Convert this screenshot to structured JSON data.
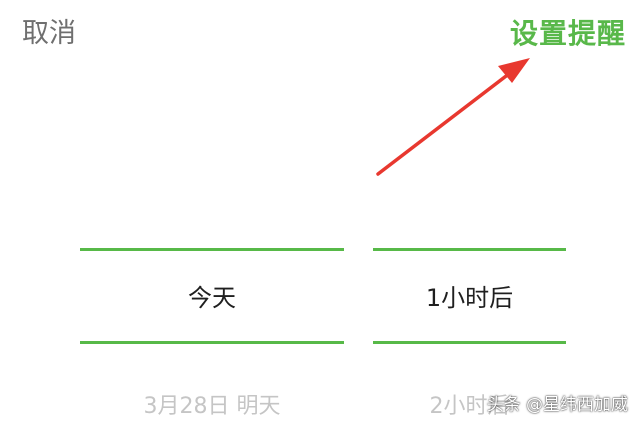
{
  "header": {
    "cancel_label": "取消",
    "confirm_label": "设置提醒"
  },
  "picker": {
    "date_column": {
      "selected": "今天",
      "next": "3月28日 明天"
    },
    "time_column": {
      "selected": "1小时后",
      "next": "2小时后"
    }
  },
  "watermark": "头条 @星纬西加威",
  "colors": {
    "accent": "#59b84a",
    "divider": "#57b948",
    "arrow": "#e8382f",
    "muted_text": "#c5c5c5",
    "cancel_text": "#6f6f6f"
  },
  "icons": {
    "arrow": "red-pointer-arrow"
  }
}
